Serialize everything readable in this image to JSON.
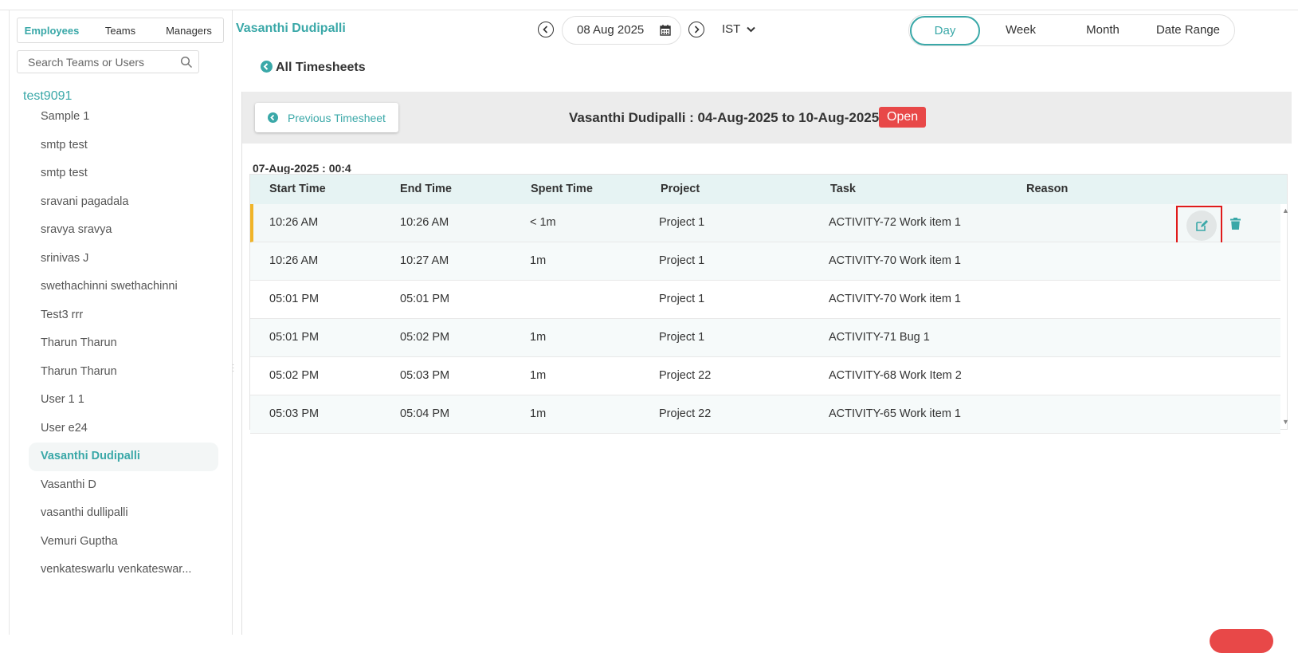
{
  "sidebar": {
    "tabs": [
      "Employees",
      "Teams",
      "Managers"
    ],
    "active_tab": "Employees",
    "search_placeholder": "Search Teams or Users",
    "org_name": "test9091",
    "users": [
      "Sample 1",
      "smtp test",
      "smtp test",
      "sravani pagadala",
      "sravya sravya",
      "srinivas J",
      "swethachinni swethachinni",
      "Test3 rrr",
      "Tharun Tharun",
      "Tharun Tharun",
      "User 1 1",
      "User e24",
      "Vasanthi Dudipalli",
      "Vasanthi D",
      "vasanthi dullipalli",
      "Vemuri Guptha",
      "venkateswarlu venkateswar..."
    ],
    "active_user": "Vasanthi Dudipalli"
  },
  "header": {
    "user_name": "Vasanthi Dudipalli",
    "date": "08 Aug 2025",
    "timezone": "IST",
    "ranges": [
      "Day",
      "Week",
      "Month",
      "Date Range"
    ],
    "active_range": "Day",
    "back_link": "All Timesheets"
  },
  "timesheet": {
    "prev_button": "Previous Timesheet",
    "title": "Vasanthi Dudipalli : 04-Aug-2025 to 10-Aug-2025",
    "status": "Open",
    "day_summary": "07-Aug-2025 : 00:4",
    "columns": [
      "Start Time",
      "End Time",
      "Spent Time",
      "Project",
      "Task",
      "Reason"
    ],
    "rows": [
      {
        "start": "10:26 AM",
        "end": "10:26 AM",
        "spent": "< 1m",
        "project": "Project 1",
        "task": "ACTIVITY-72 Work item 1",
        "reason": ""
      },
      {
        "start": "10:26 AM",
        "end": "10:27 AM",
        "spent": "1m",
        "project": "Project 1",
        "task": "ACTIVITY-70 Work item 1",
        "reason": ""
      },
      {
        "start": "05:01 PM",
        "end": "05:01 PM",
        "spent": "",
        "project": "Project 1",
        "task": "ACTIVITY-70 Work item 1",
        "reason": ""
      },
      {
        "start": "05:01 PM",
        "end": "05:02 PM",
        "spent": "1m",
        "project": "Project 1",
        "task": "ACTIVITY-71 Bug 1",
        "reason": ""
      },
      {
        "start": "05:02 PM",
        "end": "05:03 PM",
        "spent": "1m",
        "project": "Project 22",
        "task": "ACTIVITY-68 Work Item 2",
        "reason": ""
      },
      {
        "start": "05:03 PM",
        "end": "05:04 PM",
        "spent": "1m",
        "project": "Project 22",
        "task": "ACTIVITY-65 Work item 1",
        "reason": ""
      }
    ]
  },
  "colors": {
    "accent": "#3aa8a8",
    "status_open": "#e84848",
    "selected_row_marker": "#f0b429",
    "highlight_box": "#e01b1b"
  },
  "icons": {
    "search": "search-icon",
    "prev_date": "chevron-left-circle-icon",
    "next_date": "chevron-right-circle-icon",
    "calendar": "calendar-icon",
    "timezone_dropdown": "chevron-down-icon",
    "back": "back-arrow-circle-icon",
    "edit": "edit-icon",
    "delete": "trash-icon"
  }
}
